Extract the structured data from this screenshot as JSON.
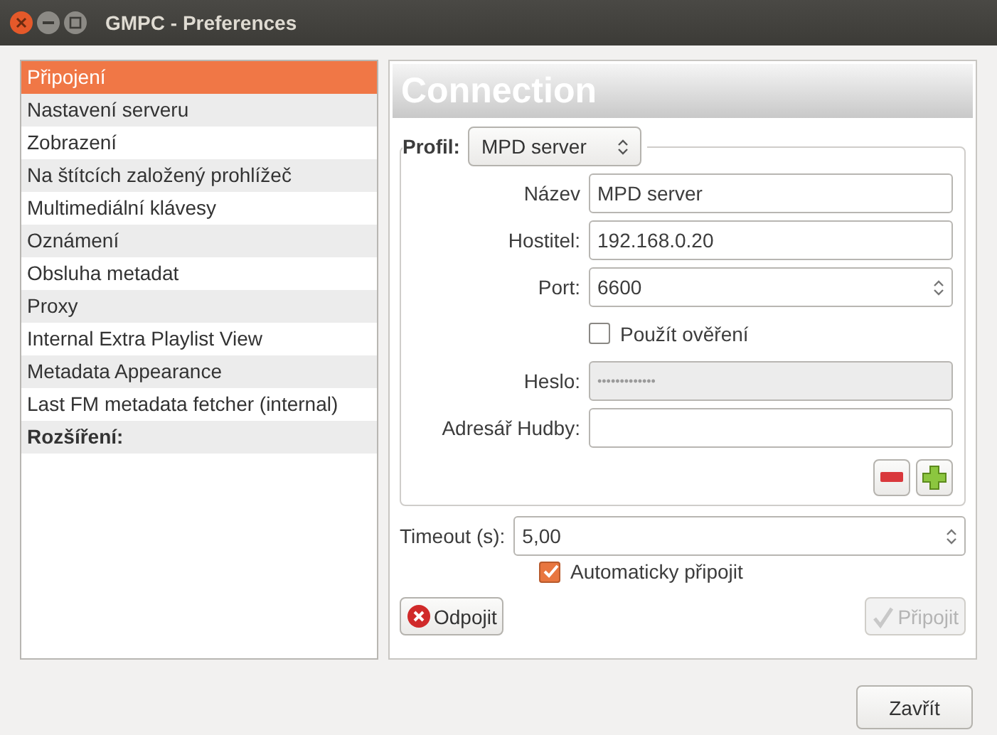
{
  "window": {
    "title": "GMPC - Preferences"
  },
  "sidebar": {
    "items": [
      {
        "label": "Připojení",
        "selected": true,
        "kind": "item"
      },
      {
        "label": "Nastavení serveru",
        "selected": false,
        "kind": "item"
      },
      {
        "label": "Zobrazení",
        "selected": false,
        "kind": "item"
      },
      {
        "label": "Na štítcích založený prohlížeč",
        "selected": false,
        "kind": "item"
      },
      {
        "label": "Multimediální klávesy",
        "selected": false,
        "kind": "item"
      },
      {
        "label": "Oznámení",
        "selected": false,
        "kind": "item"
      },
      {
        "label": "Obsluha metadat",
        "selected": false,
        "kind": "item"
      },
      {
        "label": "Proxy",
        "selected": false,
        "kind": "item"
      },
      {
        "label": "Internal Extra Playlist View",
        "selected": false,
        "kind": "item"
      },
      {
        "label": "Metadata Appearance",
        "selected": false,
        "kind": "item"
      },
      {
        "label": "Last FM metadata fetcher (internal)",
        "selected": false,
        "kind": "item"
      },
      {
        "label": "Rozšíření:",
        "selected": false,
        "kind": "header"
      }
    ]
  },
  "panel": {
    "title": "Connection",
    "profile": {
      "label": "Profil:",
      "value": "MPD server"
    },
    "fields": [
      {
        "label": "Název",
        "value": "MPD server",
        "kind": "text",
        "disabled": false
      },
      {
        "label": "Hostitel:",
        "value": "192.168.0.20",
        "kind": "text",
        "disabled": false
      },
      {
        "label": "Port:",
        "value": "6600",
        "kind": "spin",
        "disabled": false
      },
      {
        "label": "Použít ověření",
        "kind": "checkbox",
        "checked": false
      },
      {
        "label": "Heslo:",
        "value": "•••••••••••••",
        "kind": "text",
        "disabled": true
      },
      {
        "label": "Adresář Hudby:",
        "kind": "text",
        "disabled": false
      }
    ],
    "timeout": {
      "label": "Timeout (s):",
      "value": "5,00"
    },
    "auto_connect": {
      "label": "Automaticky připojit",
      "checked": true
    },
    "disconnect_button": {
      "label": "Odpojit",
      "disabled": false
    },
    "connect_button": {
      "label": "Připojit",
      "disabled": true
    }
  },
  "close_button": {
    "label": "Zavřít"
  }
}
